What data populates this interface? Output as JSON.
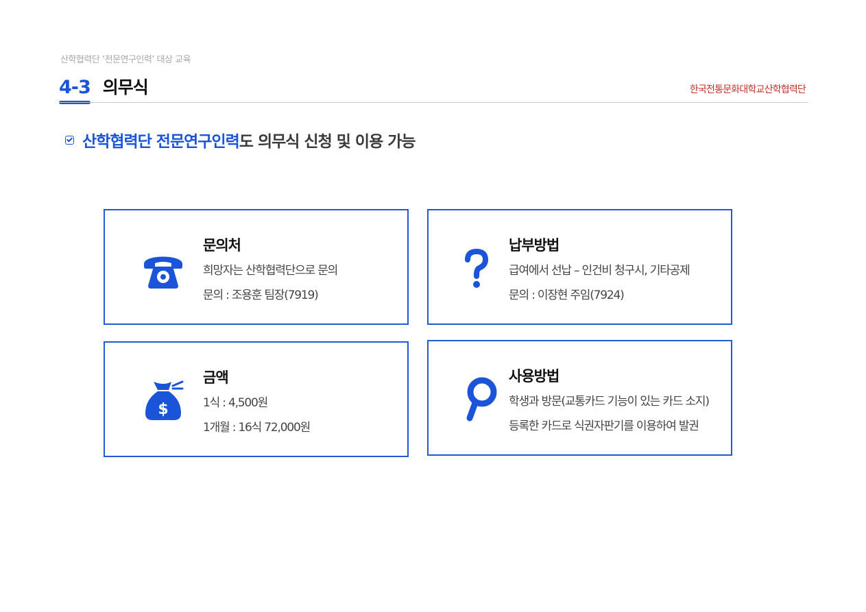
{
  "header": {
    "subtitle": "산학협력단 ‘전문연구인력’ 대상 교육",
    "section_number": "4-3",
    "section_title": "의무식",
    "organization": "한국전통문화대학교산학협력단"
  },
  "headline": {
    "highlight": "산학협력단 전문연구인력",
    "rest": "도 의무식 신청 및 이용 가능",
    "icon": "checkbox-icon"
  },
  "cards": [
    {
      "icon": "telephone-icon",
      "title": "문의처",
      "line1": "희망자는 산학협력단으로 문의",
      "line2": "문의 : 조용훈 팀장(7919)"
    },
    {
      "icon": "question-mark-icon",
      "title": "납부방법",
      "line1": "급여에서 선납 – 인건비 청구시, 기타공제",
      "line2": "문의 : 이장현 주임(7924)"
    },
    {
      "icon": "money-bag-icon",
      "title": "금액",
      "line1": "1식 : 4,500원",
      "line2": "1개월 : 16식 72,000원"
    },
    {
      "icon": "magnifier-icon",
      "title": "사용방법",
      "line1": "학생과 방문(교통카드 기능이 있는 카드 소지)",
      "line2": "등록한 카드로 식권자판기를 이용하여 발권"
    }
  ],
  "colors": {
    "accent": "#1a54d8",
    "card_border": "#1f5bd1",
    "org": "#c0312b"
  }
}
